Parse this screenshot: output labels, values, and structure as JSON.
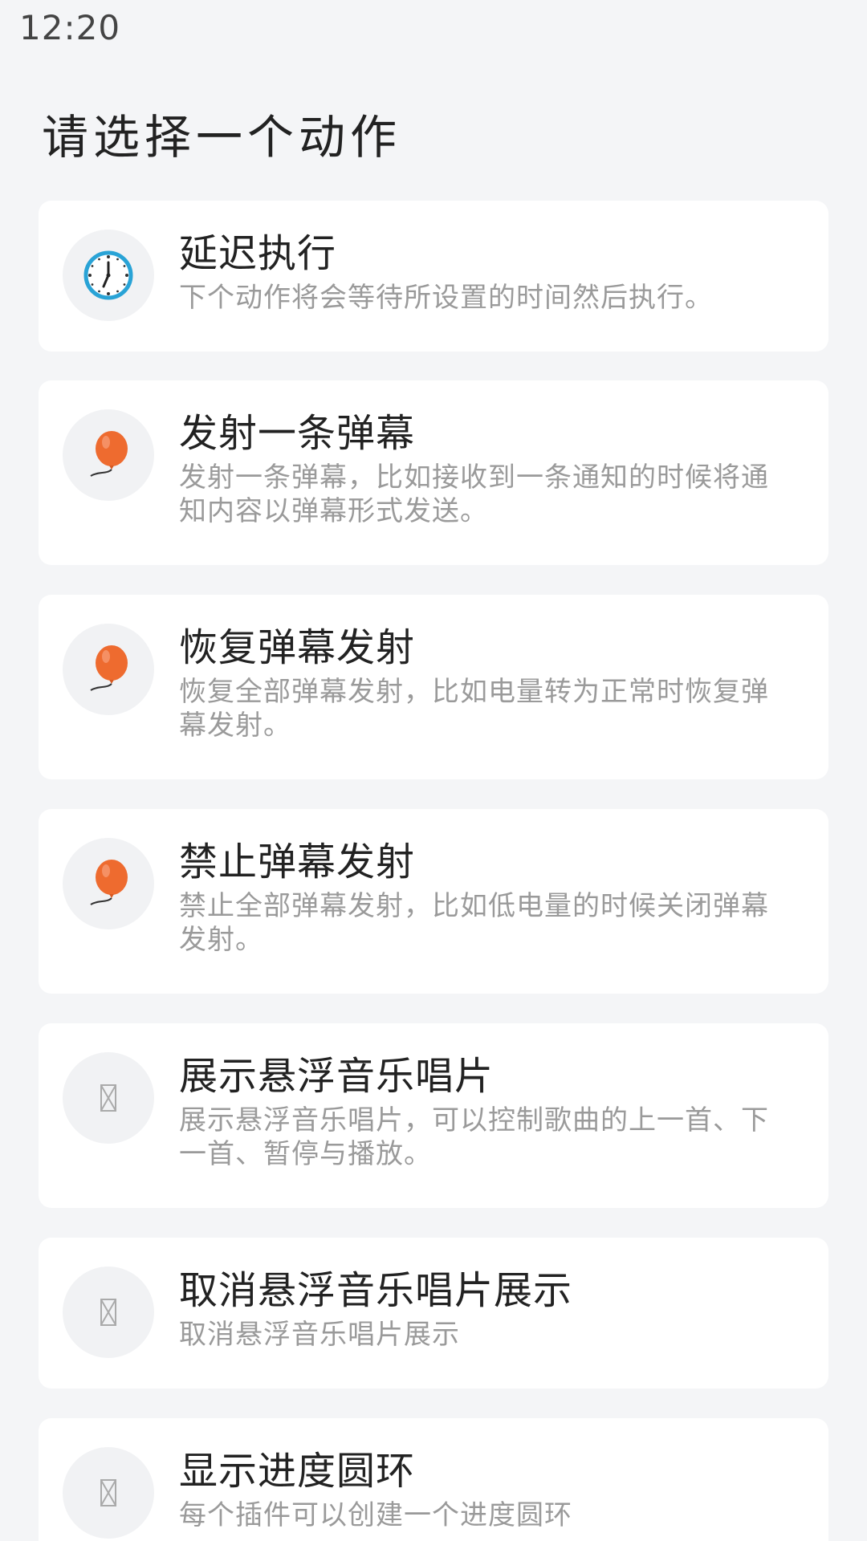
{
  "status_bar": {
    "time": "12:20"
  },
  "page": {
    "title": "请选择一个动作"
  },
  "actions": [
    {
      "title": "延迟执行",
      "description": "下个动作将会等待所设置的时间然后执行。",
      "icon": "clock-icon"
    },
    {
      "title": "发射一条弹幕",
      "description": "发射一条弹幕，比如接收到一条通知的时候将通知内容以弹幕形式发送。",
      "icon": "balloon-icon"
    },
    {
      "title": "恢复弹幕发射",
      "description": "恢复全部弹幕发射，比如电量转为正常时恢复弹幕发射。",
      "icon": "balloon-icon"
    },
    {
      "title": "禁止弹幕发射",
      "description": "禁止全部弹幕发射，比如低电量的时候关闭弹幕发射。",
      "icon": "balloon-icon"
    },
    {
      "title": "展示悬浮音乐唱片",
      "description": "展示悬浮音乐唱片，可以控制歌曲的上一首、下一首、暂停与播放。",
      "icon": "missing-glyph-icon"
    },
    {
      "title": "取消悬浮音乐唱片展示",
      "description": "取消悬浮音乐唱片展示",
      "icon": "missing-glyph-icon"
    },
    {
      "title": "显示进度圆环",
      "description": "每个插件可以创建一个进度圆环",
      "icon": "missing-glyph-icon"
    }
  ],
  "colors": {
    "background": "#f4f5f7",
    "card": "#ffffff",
    "balloon": "#ee6b2f",
    "clock_ring": "#29a3d6"
  }
}
